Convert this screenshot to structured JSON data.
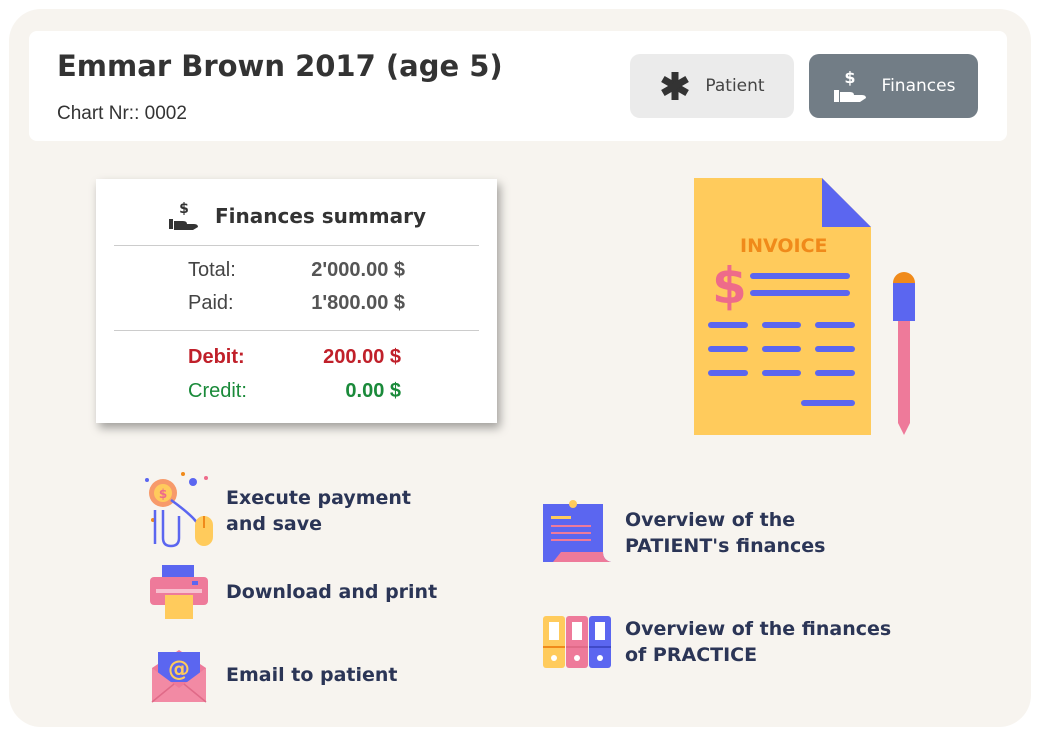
{
  "header": {
    "patient_name": "Emmar Brown 2017 (age 5)",
    "chart_nr": "Chart Nr:: 0002",
    "tabs": [
      {
        "label": "Patient",
        "icon": "asterisk-icon",
        "active": false
      },
      {
        "label": "Finances",
        "icon": "hand-dollar-icon",
        "active": true
      }
    ]
  },
  "summary": {
    "title": "Finances summary",
    "total_label": "Total:",
    "total_value": "2'000.00 $",
    "paid_label": "Paid:",
    "paid_value": "1'800.00 $",
    "debit_label": "Debit:",
    "debit_value": "200.00 $",
    "credit_label": "Credit:",
    "credit_value": "0.00 $"
  },
  "illustration": {
    "invoice_label": "INVOICE",
    "dollar_symbol": "$"
  },
  "actions": {
    "execute_payment": {
      "line1": "Execute payment",
      "line2": "and save"
    },
    "download_print": {
      "label": "Download and print"
    },
    "email_patient": {
      "label": "Email to patient"
    },
    "patient_overview": {
      "line1": "Overview of the",
      "line2": "PATIENT's finances"
    },
    "practice_overview": {
      "line1": "Overview of the finances",
      "line2": "of PRACTICE"
    }
  },
  "colors": {
    "panel": "#f7f4ef",
    "tab_active": "#727d86",
    "tab_inactive": "#ebebeb",
    "debit": "#c0202a",
    "credit": "#1a8a3a",
    "action_text": "#2b3556"
  }
}
